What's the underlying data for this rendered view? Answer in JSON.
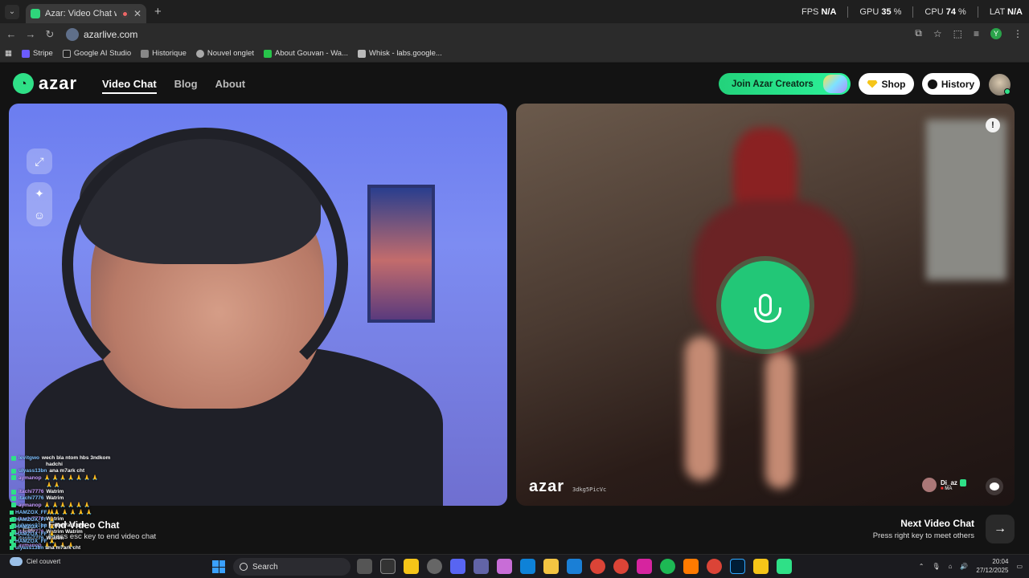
{
  "browser": {
    "tab_title": "Azar: Video Chat with New",
    "url": "azarlive.com",
    "stats": {
      "fps_label": "FPS",
      "fps_value": "N/A",
      "gpu_label": "GPU",
      "gpu_value": "35",
      "cpu_label": "CPU",
      "cpu_value": "74",
      "lat_label": "LAT",
      "lat_value": "N/A"
    },
    "bookmarks": [
      "Stripe",
      "Google AI Studio",
      "Historique",
      "Nouvel onglet",
      "About Gouvan - Wa...",
      "Whisk - labs.google..."
    ],
    "profile_initial": "Y"
  },
  "site": {
    "logo": "azar",
    "nav": [
      "Video Chat",
      "Blog",
      "About"
    ],
    "creators_button": "Join Azar Creators",
    "shop_button": "Shop",
    "history_button": "History"
  },
  "peer": {
    "watermark": "azar",
    "id": "3dkg5PicVc",
    "name": "Di_az",
    "country": "MA"
  },
  "chat_log": [
    {
      "user": "levitgwo",
      "msg": "wech bla ntom hbs 3ndkom"
    },
    {
      "user": "",
      "msg": "hadchi"
    },
    {
      "user": "ulyass13bn",
      "msg": "ana m7ark cht"
    },
    {
      "user": "aymanop",
      "msg": "🙏 🙏 🙏 🙏 🙏 🙏 🙏"
    },
    {
      "user": "",
      "msg": "🙏 🙏"
    },
    {
      "user": "itachi7776",
      "msg": "Watrim"
    },
    {
      "user": "itachi7776",
      "msg": "Watrim"
    },
    {
      "user": "aymanop",
      "msg": "🙏 🙏 🙏 🙏 🙏 🙏"
    },
    {
      "user": "",
      "msg": "🙏 🙏 🙏 🙏 🙏 🙏"
    },
    {
      "user": "itachi7776",
      "msg": "Watrim"
    },
    {
      "user": "ulyass13bn",
      "msg": "ana m7ark cht"
    },
    {
      "user": "itachi7776",
      "msg": "Watrim Watrim"
    },
    {
      "user": "itachi7776",
      "msg": "Watrim"
    },
    {
      "user": "aymanop",
      "msg": "🙏 🙏 🙏 🙏"
    }
  ],
  "overlay_chat": [
    {
      "user": "HAMZOX_FF",
      "msg": "🙏"
    },
    {
      "user": "HAMZOX_FF",
      "msg": "🙏"
    },
    {
      "user": "HAMZOX_FF",
      "msg": "🙏"
    },
    {
      "user": "HAMZOX_FF",
      "msg": "🙏"
    },
    {
      "user": "HAMZOX_FF",
      "msg": "🙏"
    },
    {
      "user": "ulyass13bn",
      "msg": "ana m7ark cht"
    }
  ],
  "controls": {
    "esc_key": "esc",
    "end_title": "End Video Chat",
    "end_sub": "Press esc key to end video chat",
    "next_title": "Next Video Chat",
    "next_sub": "Press right key to meet others"
  },
  "taskbar": {
    "weather": "Ciel couvert",
    "search_placeholder": "Search",
    "time": "20:04",
    "date": "27/12/2025"
  }
}
